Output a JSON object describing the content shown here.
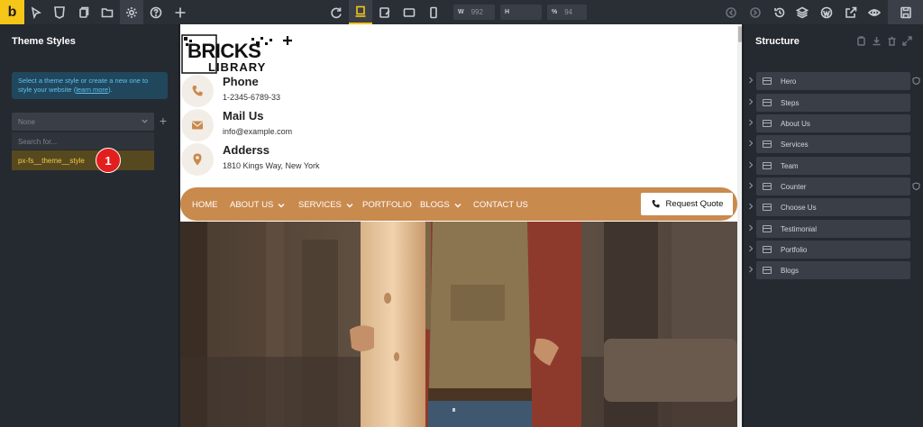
{
  "app": {
    "logo_letter": "b"
  },
  "toolbar": {
    "width_label": "W",
    "width_value": "992",
    "height_label": "H",
    "height_value": "",
    "zoom_label": "%",
    "zoom_value": "94"
  },
  "theme_styles": {
    "title": "Theme Styles",
    "info_text": "Select a theme style or create a new one to style your website (",
    "info_link": "learn more",
    "info_end": ").",
    "select_value": "None",
    "search_placeholder": "Search for...",
    "option": "px-fs__theme__style",
    "callout_number": "1"
  },
  "site": {
    "logo_top": "BRICKS",
    "logo_bottom": "LIBRARY",
    "contacts": [
      {
        "title": "Phone",
        "value": "1-2345-6789-33",
        "icon": "phone-icon"
      },
      {
        "title": "Mail Us",
        "value": "info@example.com",
        "icon": "mail-icon"
      },
      {
        "title": "Adderss",
        "value": "1810 Kings Way, New York",
        "icon": "location-pin-icon"
      }
    ],
    "nav": [
      "HOME",
      "ABOUT US",
      "SERVICES",
      "PORTFOLIO",
      "BLOGS",
      "CONTACT US"
    ],
    "quote_button": "Request Quote",
    "accent": "#c98a4e"
  },
  "structure": {
    "title": "Structure",
    "items": [
      "Hero",
      "Steps",
      "About Us",
      "Services",
      "Team",
      "Counter",
      "Choose Us",
      "Testimonial",
      "Portfolio",
      "Blogs"
    ]
  }
}
